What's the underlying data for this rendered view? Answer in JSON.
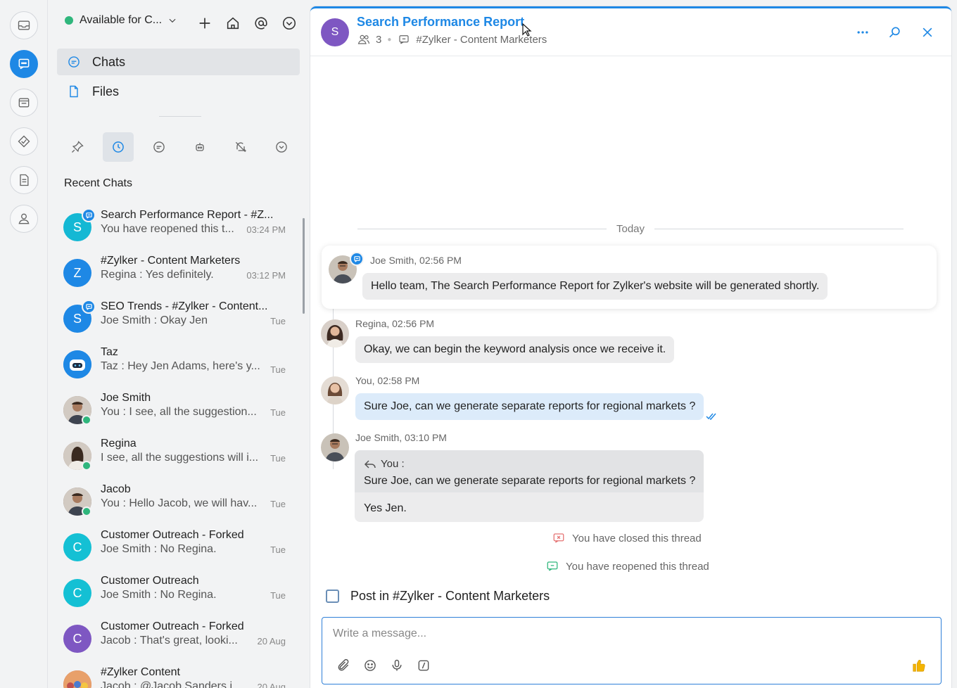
{
  "status": {
    "label": "Available for C..."
  },
  "nav": [
    {
      "label": "Chats"
    },
    {
      "label": "Files"
    }
  ],
  "section_title": "Recent Chats",
  "chats": [
    {
      "name": "Search Performance Report - #Z...",
      "preview": "You have reopened this t...",
      "time": "03:24 PM",
      "initial": "S",
      "color": "#14b8d4"
    },
    {
      "name": "#Zylker - Content Marketers",
      "preview": "Regina : Yes definitely.",
      "time": "03:12 PM",
      "initial": "Z",
      "color": "#1e88e5"
    },
    {
      "name": "SEO Trends - #Zylker - Content...",
      "preview": "Joe Smith : Okay Jen",
      "time": "Tue",
      "initial": "S",
      "color": "#1e88e5"
    },
    {
      "name": "Taz",
      "preview": "Taz : Hey Jen Adams, here's y...",
      "time": "Tue",
      "initial": "",
      "color": "#1e88e5"
    },
    {
      "name": "Joe Smith",
      "preview": "You : I see, all the suggestion...",
      "time": "Tue",
      "initial": "",
      "color": "#8a7a6a"
    },
    {
      "name": "Regina",
      "preview": "I see, all the suggestions will i...",
      "time": "Tue",
      "initial": "",
      "color": "#a07a6a"
    },
    {
      "name": "Jacob",
      "preview": "You : Hello Jacob, we will hav...",
      "time": "Tue",
      "initial": "",
      "color": "#6f5a4d"
    },
    {
      "name": "Customer Outreach - Forked",
      "preview": "Joe Smith : No Regina.",
      "time": "Tue",
      "initial": "C",
      "color": "#14c0d4"
    },
    {
      "name": "Customer Outreach",
      "preview": "Joe Smith : No Regina.",
      "time": "Tue",
      "initial": "C",
      "color": "#14c0d4"
    },
    {
      "name": "Customer Outreach - Forked",
      "preview": "Jacob : That's great, looki...",
      "time": "20 Aug",
      "initial": "C",
      "color": "#7e57c2"
    },
    {
      "name": "#Zylker Content",
      "preview": "Jacob : @Jacob Sanders i...",
      "time": "20 Aug",
      "initial": "",
      "color": "#c0504d"
    }
  ],
  "header": {
    "initial": "S",
    "title": "Search Performance Report",
    "members": "3",
    "channel": "#Zylker - Content Marketers"
  },
  "today_label": "Today",
  "messages": [
    {
      "meta": "Joe Smith, 02:56 PM",
      "text": "Hello team, The Search Performance Report for Zylker's website will be generated shortly."
    },
    {
      "meta": "Regina, 02:56 PM",
      "text": "Okay, we can begin the keyword analysis once we receive it."
    },
    {
      "meta": "You, 02:58 PM",
      "text": "Sure Joe, can we generate separate reports for regional markets ?"
    },
    {
      "meta": "Joe Smith, 03:10 PM",
      "quote_who": "You :",
      "quote_text": "Sure Joe, can we generate separate reports for regional markets ?",
      "text": "Yes Jen."
    }
  ],
  "system": {
    "closed": "You have closed this thread",
    "reopened": "You have reopened this thread"
  },
  "post_in": "Post in #Zylker - Content Marketers",
  "composer": {
    "placeholder": "Write a message..."
  },
  "colors": {
    "accent": "#1e88e5",
    "online": "#2fb67c",
    "closed": "#e57373",
    "reopened": "#2fb67c"
  }
}
